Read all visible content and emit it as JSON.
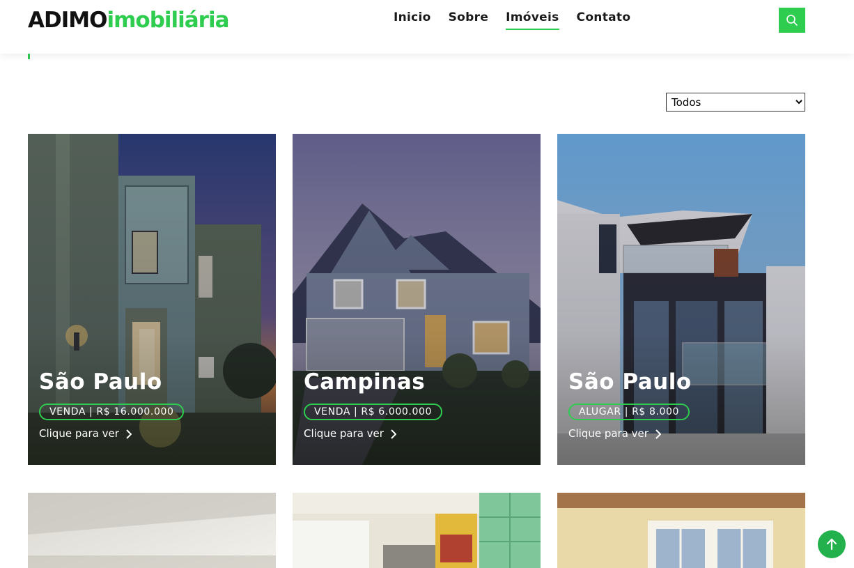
{
  "header": {
    "logo_part1": "ADIMO",
    "logo_part2": "imobiliária",
    "nav": [
      {
        "label": "Inicio",
        "active": false
      },
      {
        "label": "Sobre",
        "active": false
      },
      {
        "label": "Imóveis",
        "active": true
      },
      {
        "label": "Contato",
        "active": false
      }
    ],
    "search_icon": "search-icon"
  },
  "filter": {
    "selected": "Todos",
    "options": [
      "Todos"
    ]
  },
  "listings": [
    {
      "city": "São Paulo",
      "badge": "VENDA | R$ 16.000.000",
      "cta": "Clique para ver"
    },
    {
      "city": "Campinas",
      "badge": "VENDA | R$ 6.000.000",
      "cta": "Clique para ver"
    },
    {
      "city": "São Paulo",
      "badge": "ALUGAR | R$ 8.000",
      "cta": "Clique para ver"
    }
  ],
  "colors": {
    "accent": "#2ecc4f",
    "scroll_top": "#22b14c"
  },
  "scroll_top_icon": "arrow-up-icon"
}
